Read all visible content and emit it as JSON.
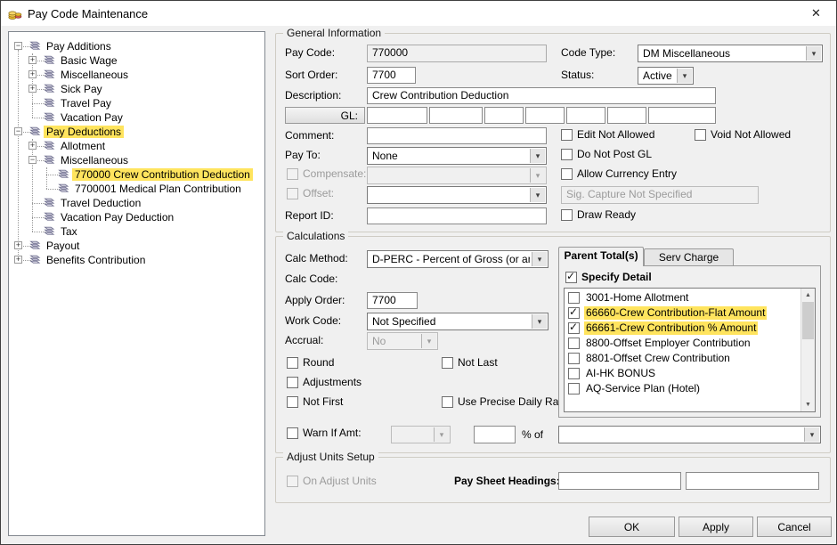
{
  "window": {
    "title": "Pay Code Maintenance",
    "close_glyph": "✕"
  },
  "colors": {
    "highlight": "#ffe45e",
    "dialog_bg": "#f0f0f0"
  },
  "tree": {
    "items": [
      {
        "label": "Pay Additions",
        "level": 0,
        "expander": "-",
        "highlight": false
      },
      {
        "label": "Basic Wage",
        "level": 1,
        "expander": "+",
        "highlight": false
      },
      {
        "label": "Miscellaneous",
        "level": 1,
        "expander": "+",
        "highlight": false
      },
      {
        "label": "Sick Pay",
        "level": 1,
        "expander": "+",
        "highlight": false
      },
      {
        "label": "Travel Pay",
        "level": 1,
        "expander": null,
        "highlight": false
      },
      {
        "label": "Vacation Pay",
        "level": 1,
        "expander": null,
        "highlight": false
      },
      {
        "label": "Pay Deductions",
        "level": 0,
        "expander": "-",
        "highlight": true
      },
      {
        "label": "Allotment",
        "level": 1,
        "expander": "+",
        "highlight": false
      },
      {
        "label": "Miscellaneous",
        "level": 1,
        "expander": "-",
        "highlight": false
      },
      {
        "label": "770000 Crew Contribution Deduction",
        "level": 2,
        "expander": null,
        "highlight": true
      },
      {
        "label": "7700001 Medical Plan Contribution",
        "level": 2,
        "expander": null,
        "highlight": false
      },
      {
        "label": "Travel Deduction",
        "level": 1,
        "expander": null,
        "highlight": false
      },
      {
        "label": "Vacation Pay Deduction",
        "level": 1,
        "expander": null,
        "highlight": false
      },
      {
        "label": "Tax",
        "level": 1,
        "expander": null,
        "highlight": false
      },
      {
        "label": "Payout",
        "level": 0,
        "expander": "+",
        "highlight": false
      },
      {
        "label": "Benefits Contribution",
        "level": 0,
        "expander": "+",
        "highlight": false
      }
    ]
  },
  "general": {
    "title": "General Information",
    "pay_code_label": "Pay Code:",
    "pay_code_value": "770000",
    "code_type_label": "Code Type:",
    "code_type_value": "DM Miscellaneous",
    "sort_order_label": "Sort Order:",
    "sort_order_value": "7700",
    "status_label": "Status:",
    "status_value": "Active",
    "description_label": "Description:",
    "description_value": "Crew Contribution Deduction",
    "gl_button_label": "GL:",
    "gl_segments": [
      "",
      "",
      "",
      "",
      "",
      "",
      ""
    ],
    "comment_label": "Comment:",
    "comment_value": "",
    "pay_to_label": "Pay To:",
    "pay_to_value": "None",
    "compensate_label": "Compensate:",
    "compensate_value": "",
    "offset_label": "Offset:",
    "offset_value": "",
    "sig_capture_value": "Sig. Capture Not Specified",
    "report_id_label": "Report ID:",
    "report_id_value": "",
    "cb_edit_not_allowed": "Edit Not Allowed",
    "cb_void_not_allowed": "Void Not Allowed",
    "cb_do_not_post_gl": "Do Not Post GL",
    "cb_allow_currency_entry": "Allow Currency Entry",
    "cb_draw_ready": "Draw Ready"
  },
  "calculations": {
    "title": "Calculations",
    "calc_method_label": "Calc Method:",
    "calc_method_value": "D-PERC - Percent of Gross (or anoth",
    "calc_code_label": "Calc Code:",
    "apply_order_label": "Apply Order:",
    "apply_order_value": "7700",
    "work_code_label": "Work Code:",
    "work_code_value": "Not Specified",
    "accrual_label": "Accrual:",
    "accrual_value": "No",
    "cb_round": "Round",
    "cb_not_last": "Not Last",
    "cb_adjustments": "Adjustments",
    "cb_not_first": "Not First",
    "cb_use_precise": "Use Precise Daily Rate",
    "warn_if_amt_label": "Warn If Amt:",
    "warn_dd_value": "",
    "warn_amount_value": "",
    "percent_of_label": "% of",
    "warn_target_value": "",
    "tabs": [
      {
        "label": "Parent Total(s)",
        "active": true
      },
      {
        "label": "Serv Charge Pools",
        "active": false
      }
    ],
    "specify_detail_label": "Specify Detail",
    "parent_totals": [
      {
        "label": "3001-Home Allotment",
        "checked": false,
        "highlight": false
      },
      {
        "label": "66660-Crew Contribution-Flat Amount",
        "checked": true,
        "highlight": true
      },
      {
        "label": "66661-Crew Contribution % Amount",
        "checked": true,
        "highlight": true
      },
      {
        "label": "8800-Offset Employer Contribution",
        "checked": false,
        "highlight": false
      },
      {
        "label": "8801-Offset Crew Contribution",
        "checked": false,
        "highlight": false
      },
      {
        "label": "AI-HK BONUS",
        "checked": false,
        "highlight": false
      },
      {
        "label": "AQ-Service Plan (Hotel)",
        "checked": false,
        "highlight": false
      }
    ]
  },
  "adjust_units": {
    "title": "Adjust Units Setup",
    "cb_on_adjust_units": "On Adjust Units",
    "pay_sheet_headings_label": "Pay Sheet Headings:",
    "field1_value": "",
    "field2_value": ""
  },
  "buttons": {
    "ok": "OK",
    "apply": "Apply",
    "cancel": "Cancel"
  }
}
